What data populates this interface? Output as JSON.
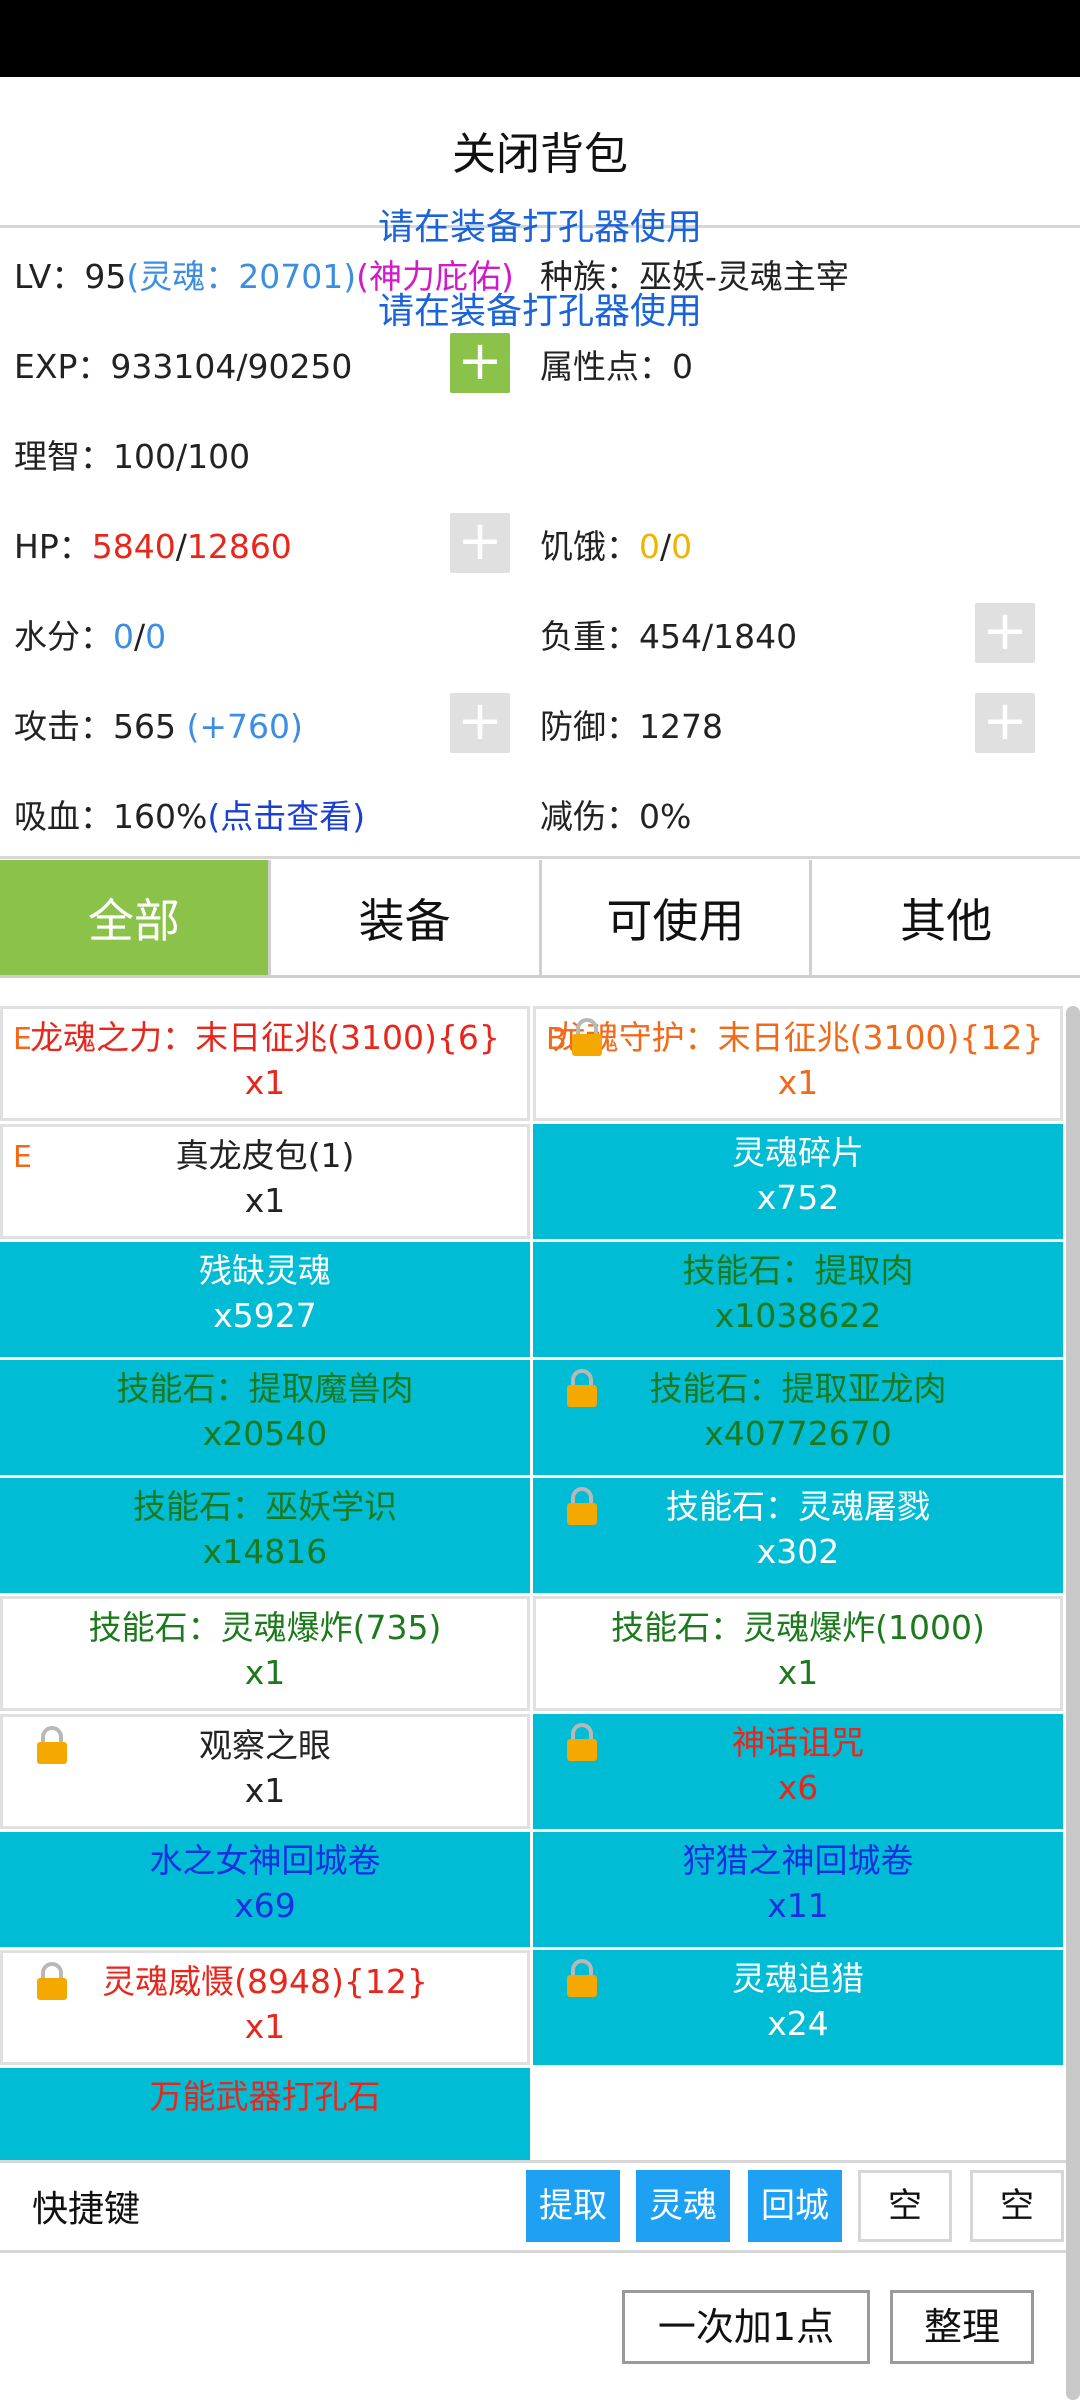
{
  "header": {
    "title": "关闭背包"
  },
  "notice": {
    "line1": "请在装备打孔器使用",
    "line2": "请在装备打孔器使用"
  },
  "stats": {
    "lv_label": "LV：",
    "lv_value": "95",
    "lv_soul": "(灵魂：20701)",
    "lv_blessing": "(神力庇佑)",
    "race": "种族：巫妖-灵魂主宰",
    "exp": "EXP：933104/90250",
    "attr_points": "属性点：0",
    "sanity": "理智：100/100",
    "hp_label": "HP：",
    "hp_cur": "5840",
    "hp_sep": "/",
    "hp_max": "12860",
    "hunger_label": "饥饿：",
    "hunger_cur": "0",
    "hunger_sep": "/",
    "hunger_max": "0",
    "water_label": "水分：",
    "water_cur": "0",
    "water_sep": "/",
    "water_max": "0",
    "load": "负重：454/1840",
    "attack_label": "攻击：565 ",
    "attack_bonus": "(+760)",
    "defense": "防御：1278",
    "lifesteal_label": "吸血：160%",
    "lifesteal_link": "(点击查看)",
    "dmg_reduction": "减伤：0%",
    "plus_glyph": "+"
  },
  "tabs": [
    {
      "label": "全部"
    },
    {
      "label": "装备"
    },
    {
      "label": "可使用"
    },
    {
      "label": "其他"
    }
  ],
  "items": [
    {
      "name": "龙魂之力：末日征兆(3100){6}",
      "qty": "x1",
      "tag": "E"
    },
    {
      "name": "龙魂守护：末日征兆(3100){12}",
      "qty": "x1",
      "tag": "B"
    },
    {
      "name": "真龙皮包(1)",
      "qty": "x1",
      "tag": "E"
    },
    {
      "name": "灵魂碎片",
      "qty": "x752"
    },
    {
      "name": "残缺灵魂",
      "qty": "x5927"
    },
    {
      "name": "技能石：提取肉",
      "qty": "x1038622"
    },
    {
      "name": "技能石：提取魔兽肉",
      "qty": "x20540"
    },
    {
      "name": "技能石：提取亚龙肉",
      "qty": "x40772670"
    },
    {
      "name": "技能石：巫妖学识",
      "qty": "x14816"
    },
    {
      "name": "技能石：灵魂屠戮",
      "qty": "x302"
    },
    {
      "name": "技能石：灵魂爆炸(735)",
      "qty": "x1"
    },
    {
      "name": "技能石：灵魂爆炸(1000)",
      "qty": "x1"
    },
    {
      "name": "观察之眼",
      "qty": "x1"
    },
    {
      "name": "神话诅咒",
      "qty": "x6"
    },
    {
      "name": "水之女神回城卷",
      "qty": "x69"
    },
    {
      "name": "狩猎之神回城卷",
      "qty": "x11"
    },
    {
      "name": "灵魂威慑(8948){12}",
      "qty": "x1"
    },
    {
      "name": "灵魂追猎",
      "qty": "x24"
    },
    {
      "name": "万能武器打孔石",
      "qty": ""
    }
  ],
  "quickbar": {
    "label": "快捷键",
    "slots": [
      "提取",
      "灵魂",
      "回城",
      "空",
      "空"
    ]
  },
  "actions": {
    "add_one": "一次加1点",
    "sort": "整理"
  },
  "colors": {
    "accent_green": "#8bc34a",
    "item_teal": "#00bcd4",
    "quick_blue": "#1ea1f2",
    "hp_red": "#e8261c",
    "notice_blue": "#1b63d9"
  }
}
